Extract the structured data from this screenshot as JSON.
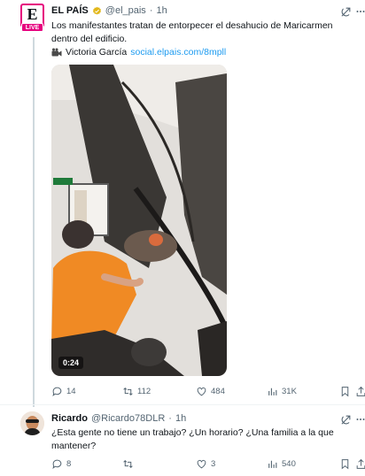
{
  "tweets": [
    {
      "author_name": "EL PAÍS",
      "handle": "@el_pais",
      "separator": "·",
      "time": "1h",
      "verified": true,
      "avatar_badge": "LIVE",
      "avatar_logo": "E",
      "text": "Los manifestantes tratan de entorpecer el desahucio de Maricarmen dentro del edificio.",
      "credit_name": "Victoria García",
      "credit_link": "social.elpais.com/8mpll",
      "video_duration": "0:24",
      "stats": {
        "replies": "14",
        "retweets": "112",
        "likes": "484",
        "views": "31K"
      }
    },
    {
      "author_name": "Ricardo",
      "handle": "@Ricardo78DLR",
      "separator": "·",
      "time": "1h",
      "text": "¿Esta gente no tiene un trabajo? ¿Un horario? ¿Una familia a la que mantener?",
      "stats": {
        "replies": "8",
        "retweets": "",
        "likes": "3",
        "views": "540"
      }
    }
  ],
  "icons": {
    "verified": "verified-badge-icon",
    "grok": "grok-icon",
    "more": "more-icon",
    "camera": "video-camera-icon",
    "reply": "reply-icon",
    "retweet": "retweet-icon",
    "like": "like-icon",
    "views": "views-icon",
    "bookmark": "bookmark-icon",
    "share": "share-icon"
  },
  "colors": {
    "accent_link": "#1d9bf0",
    "brand_live": "#e6007e",
    "verified_gold": "#e2b719",
    "muted_text": "#536471",
    "thread_line": "#cfd9de"
  }
}
